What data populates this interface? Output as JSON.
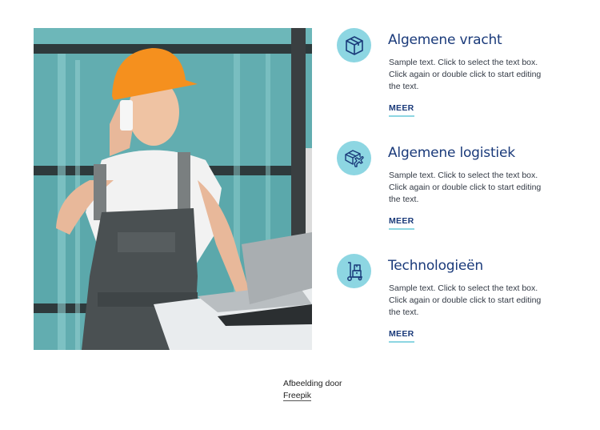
{
  "photo": {
    "alt": "Worker in orange hard hat on phone using laptop in warehouse",
    "colors": {
      "background": "#5fa9ad",
      "helmet": "#f5901e",
      "overalls": "#4a5052",
      "shirt": "#f2f2f2"
    }
  },
  "features": [
    {
      "icon": "box-icon",
      "title": "Algemene vracht",
      "description": "Sample text. Click to select the text box. Click again or double click to start editing the text.",
      "link_label": "MEER"
    },
    {
      "icon": "box-airplane-icon",
      "title": "Algemene logistiek",
      "description": "Sample text. Click to select the text box. Click again or double click to start editing the text.",
      "link_label": "MEER"
    },
    {
      "icon": "hand-truck-icon",
      "title": "Technologieën",
      "description": "Sample text. Click to select the text box. Click again or double click to start editing the text.",
      "link_label": "MEER"
    }
  ],
  "credit": {
    "prefix": "Afbeelding door",
    "link_label": "Freepik"
  },
  "colors": {
    "accent": "#8dd6e2",
    "heading": "#1a3a7a",
    "text": "#333a45"
  }
}
